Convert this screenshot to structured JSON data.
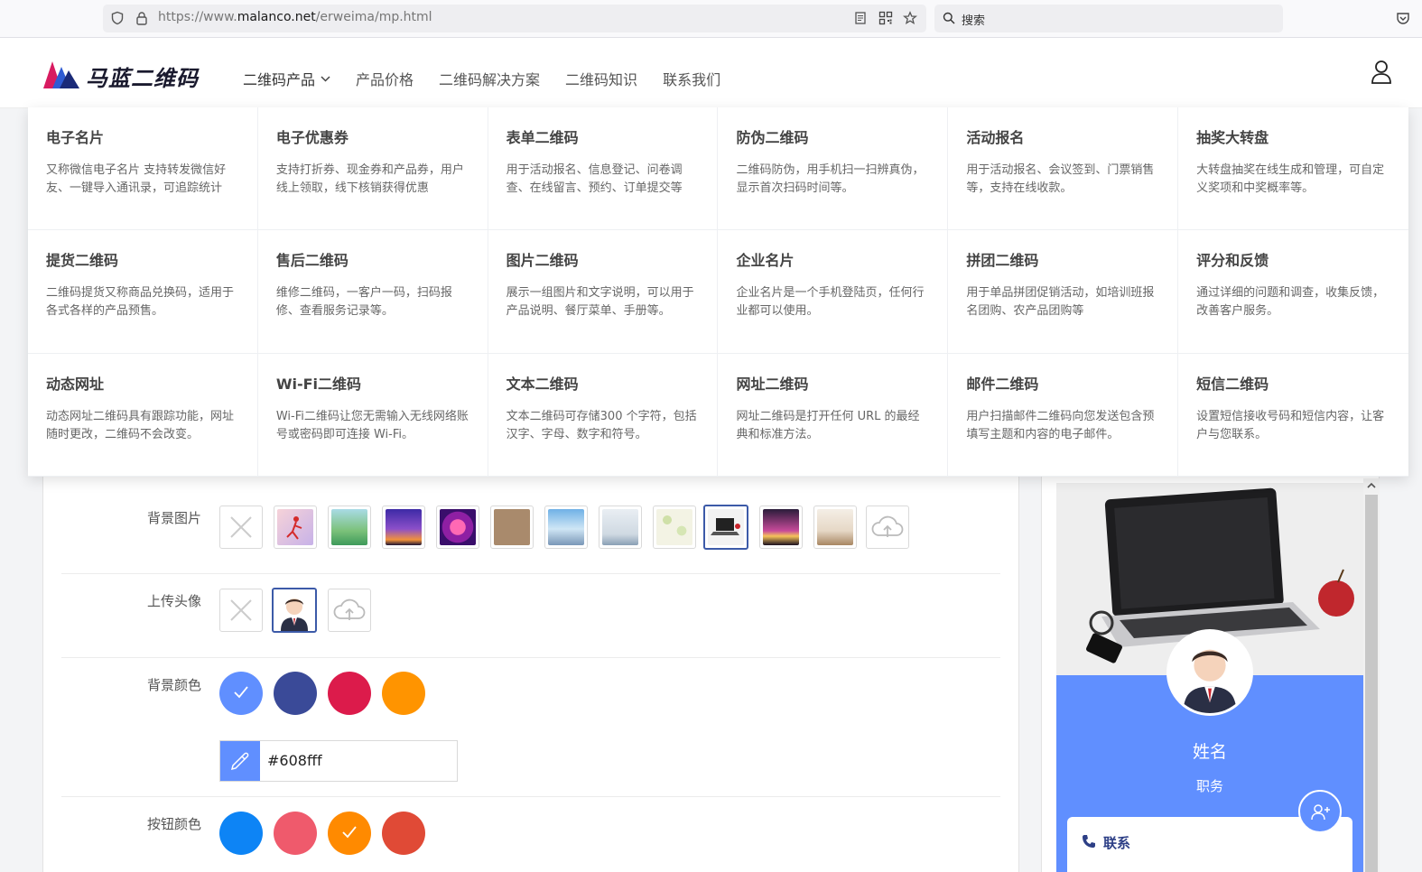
{
  "browser": {
    "url_prefix": "https://www.",
    "url_domain": "malanco.net",
    "url_path": "/erweima/mp.html",
    "search_placeholder": "搜索"
  },
  "site": {
    "logo_text": "马蓝二维码",
    "nav": [
      {
        "label": "二维码产品",
        "has_dropdown": true
      },
      {
        "label": "产品价格"
      },
      {
        "label": "二维码解决方案"
      },
      {
        "label": "二维码知识"
      },
      {
        "label": "联系我们"
      }
    ]
  },
  "menu": [
    {
      "title": "电子名片",
      "desc": "又称微信电子名片 支持转发微信好友、一键导入通讯录，可追踪统计"
    },
    {
      "title": "电子优惠券",
      "desc": "支持打折券、现金券和产品券，用户线上领取，线下核销获得优惠"
    },
    {
      "title": "表单二维码",
      "desc": "用于活动报名、信息登记、问卷调查、在线留言、预约、订单提交等"
    },
    {
      "title": "防伪二维码",
      "desc": "二维码防伪，用手机扫一扫辨真伪，显示首次扫码时间等。"
    },
    {
      "title": "活动报名",
      "desc": "用于活动报名、会议签到、门票销售等，支持在线收款。"
    },
    {
      "title": "抽奖大转盘",
      "desc": "大转盘抽奖在线生成和管理，可自定义奖项和中奖概率等。"
    },
    {
      "title": "提货二维码",
      "desc": "二维码提货又称商品兑换码，适用于各式各样的产品预售。"
    },
    {
      "title": "售后二维码",
      "desc": "维修二维码，一客户一码，扫码报修、查看服务记录等。"
    },
    {
      "title": "图片二维码",
      "desc": "展示一组图片和文字说明，可以用于产品说明、餐厅菜单、手册等。"
    },
    {
      "title": "企业名片",
      "desc": "企业名片是一个手机登陆页，任何行业都可以使用。"
    },
    {
      "title": "拼团二维码",
      "desc": "用于单品拼团促销活动，如培训班报名团购、农产品团购等"
    },
    {
      "title": "评分和反馈",
      "desc": "通过详细的问题和调查，收集反馈，改善客户服务。"
    },
    {
      "title": "动态网址",
      "desc": "动态网址二维码具有跟踪功能，网址随时更改，二维码不会改变。"
    },
    {
      "title": "Wi-Fi二维码",
      "desc": "Wi-Fi二维码让您无需输入无线网络账号或密码即可连接 Wi-Fi。"
    },
    {
      "title": "文本二维码",
      "desc": "文本二维码可存储300 个字符，包括汉字、字母、数字和符号。"
    },
    {
      "title": "网址二维码",
      "desc": "网址二维码是打开任何 URL 的最经典和标准方法。"
    },
    {
      "title": "邮件二维码",
      "desc": "用户扫描邮件二维码向您发送包含预填写主题和内容的电子邮件。"
    },
    {
      "title": "短信二维码",
      "desc": "设置短信接收号码和短信内容，让客户与您联系。"
    }
  ],
  "editor": {
    "bg_image_label": "背景图片",
    "avatar_label": "上传头像",
    "bg_color_label": "背景颜色",
    "btn_color_label": "按钮颜色",
    "bg_color_value": "#608fff",
    "bg_colors": [
      "#608fff",
      "#3a4a98",
      "#dc1b4b",
      "#ff9400"
    ],
    "btn_colors": [
      "#0d84f5",
      "#ef5a6c",
      "#ff8a00",
      "#e04a36"
    ]
  },
  "preview": {
    "name": "姓名",
    "title": "职务",
    "contact_label": "联系"
  }
}
